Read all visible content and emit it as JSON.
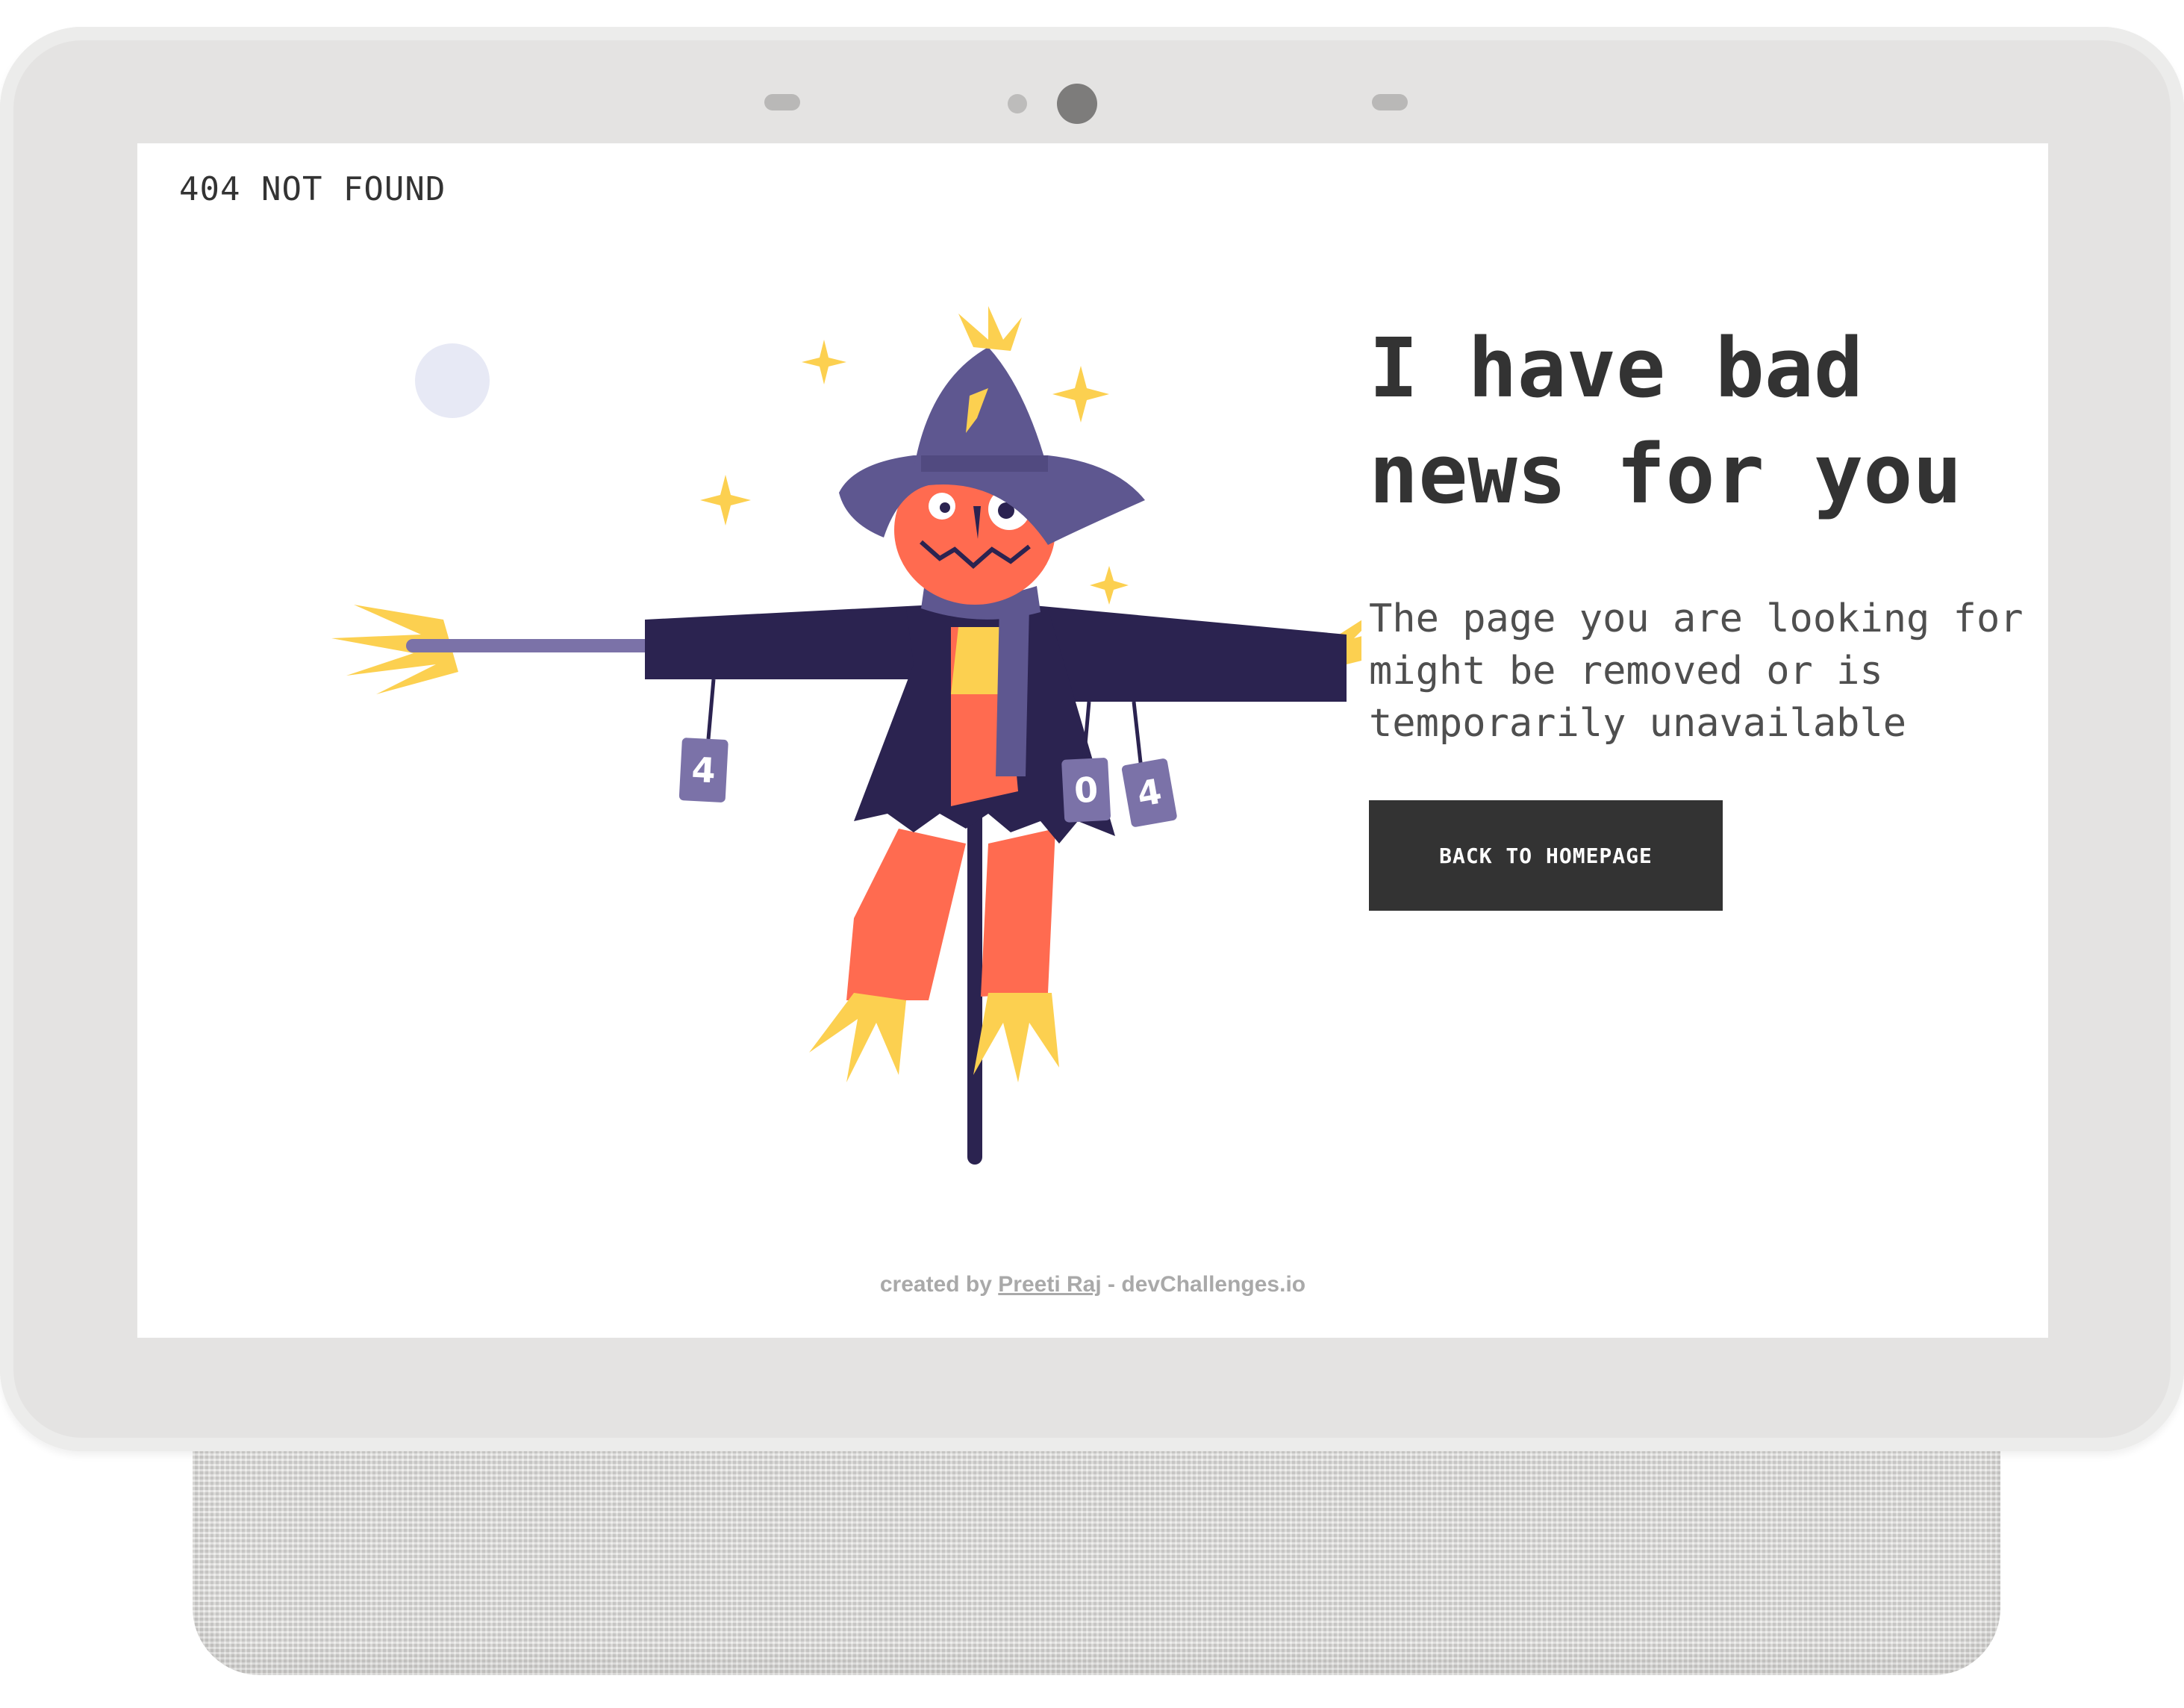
{
  "brand": {
    "title": "404 NOT FOUND"
  },
  "hero": {
    "headline": "I have bad news for you",
    "description": "The page you are looking for might be removed or is temporarily unavailable",
    "cta_label": "BACK TO HOMEPAGE"
  },
  "illustration": {
    "cans": [
      "4",
      "0",
      "4"
    ]
  },
  "footer": {
    "prefix": "created by",
    "author": "Preeti Raj",
    "separator": "-",
    "site": "devChallenges.io"
  },
  "colors": {
    "text_dark": "#333333",
    "button_bg": "#333333",
    "button_text": "#ffffff",
    "footer_text": "#a9a9a9",
    "coat": "#2b2350",
    "hat": "#5e5790",
    "pumpkin": "#ff6b50",
    "straw": "#fcd050",
    "can": "#7b72a8",
    "moon": "#e7e9f5"
  }
}
